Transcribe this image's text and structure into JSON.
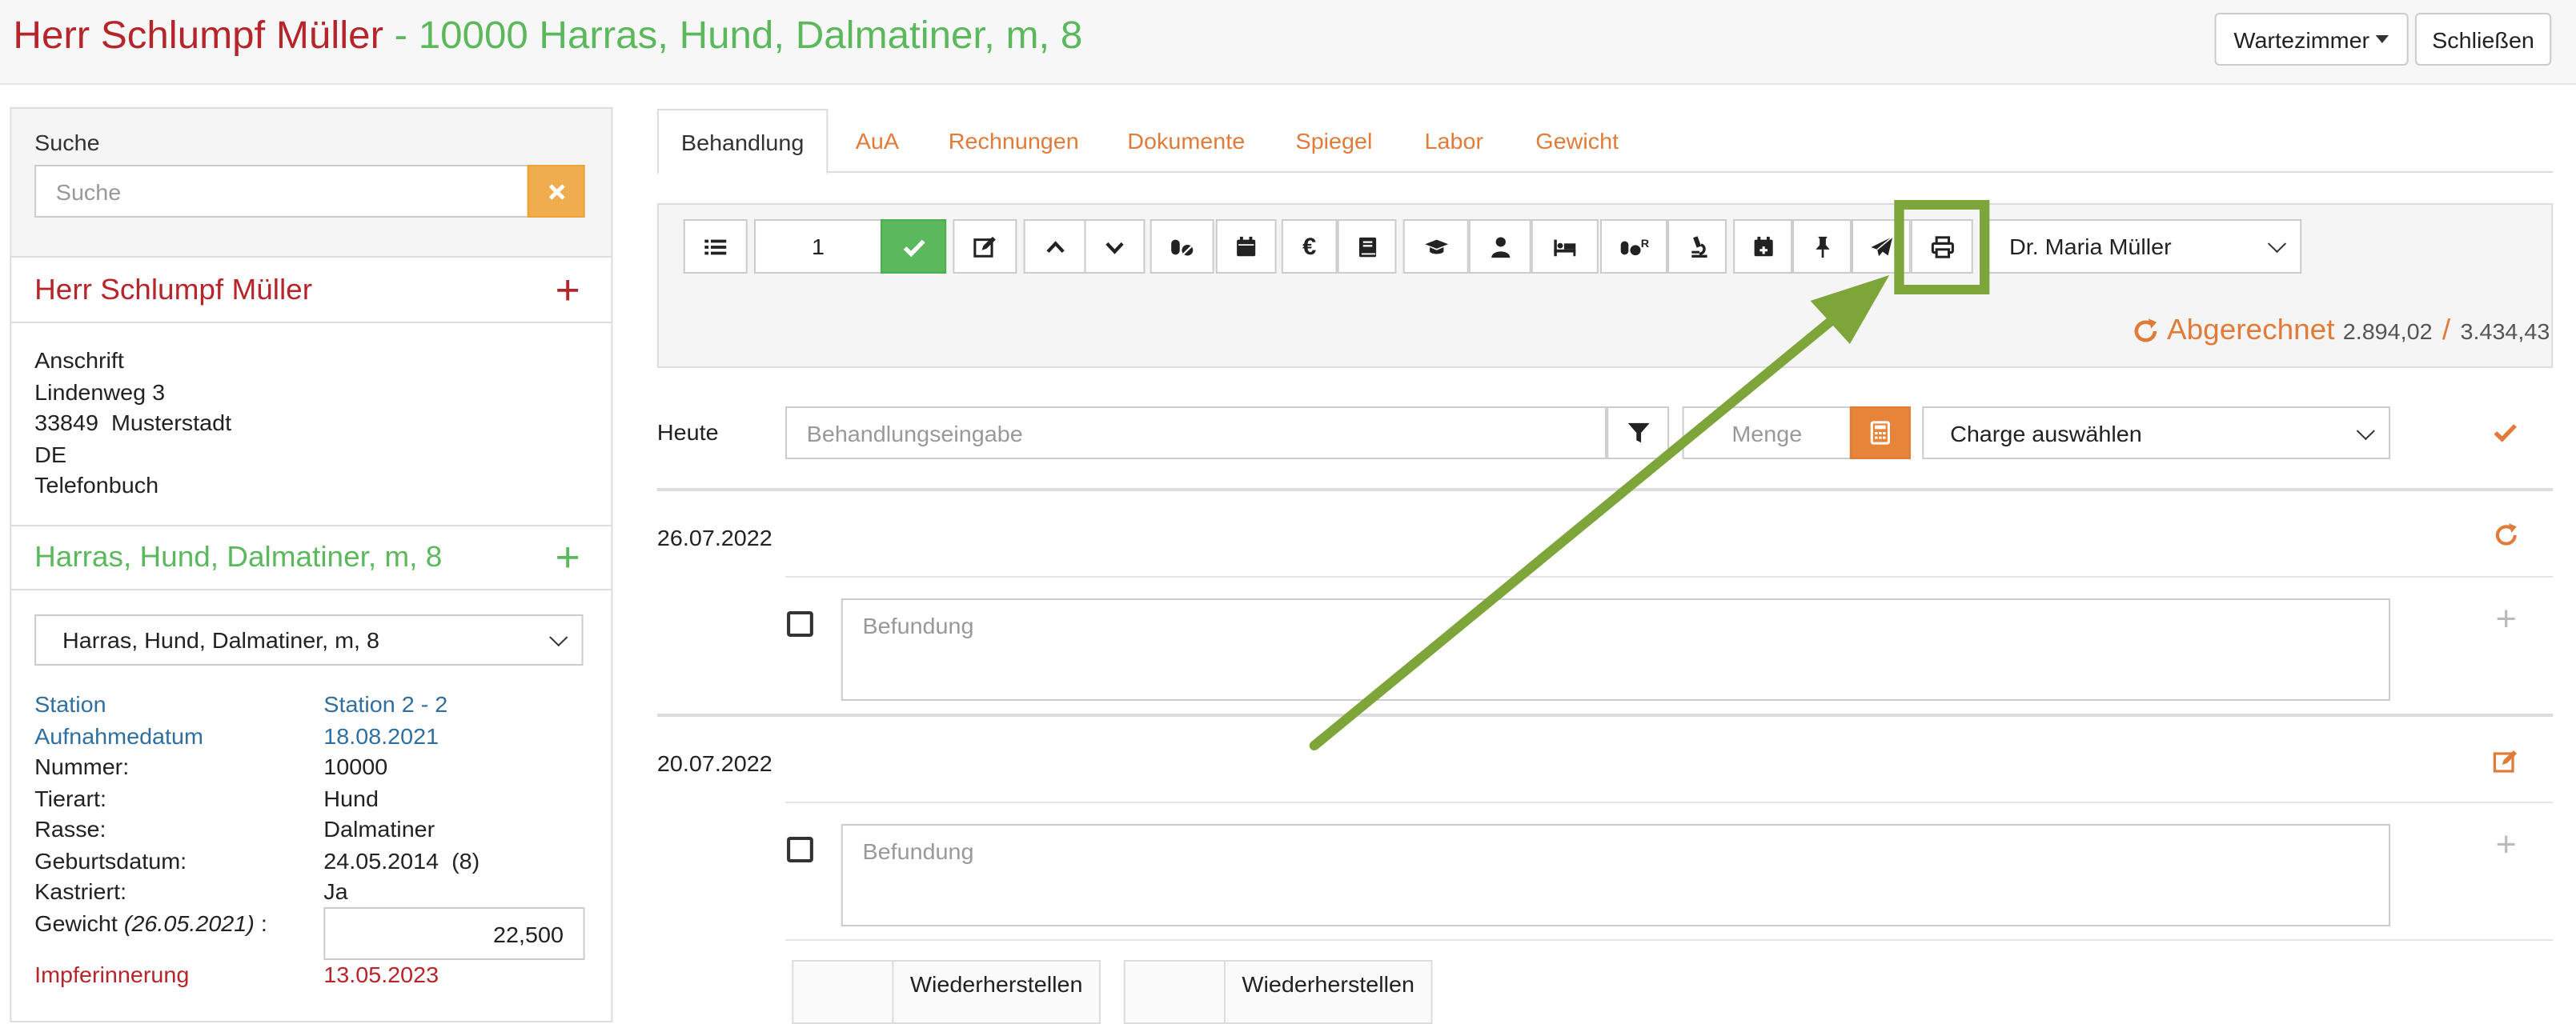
{
  "header": {
    "owner": "Herr Schlumpf Müller",
    "separator": " - ",
    "patient": "10000 Harras, Hund, Dalmatiner, m, 8",
    "waiting_room_label": "Wartezimmer",
    "close_label": "Schließen"
  },
  "sidebar": {
    "search_label": "Suche",
    "search_placeholder": "Suche",
    "owner_name": "Herr Schlumpf Müller",
    "address_lines": [
      "Anschrift",
      "Lindenweg 3",
      "33849  Musterstadt",
      "DE",
      "Telefonbuch"
    ],
    "patient_title": "Harras, Hund, Dalmatiner, m, 8",
    "patient_select": "Harras, Hund, Dalmatiner, m, 8",
    "details": [
      {
        "label": "Station",
        "value": "Station 2 - 2",
        "color": "blue"
      },
      {
        "label": "Aufnahmedatum",
        "value": "18.08.2021",
        "color": "blue"
      },
      {
        "label": "Nummer:",
        "value": "10000"
      },
      {
        "label": "Tierart:",
        "value": "Hund"
      },
      {
        "label": "Rasse:",
        "value": "Dalmatiner"
      },
      {
        "label": "Geburtsdatum:",
        "value": "24.05.2014  (8)"
      },
      {
        "label": "Kastriert:",
        "value": "Ja"
      }
    ],
    "weight_label": "Gewicht",
    "weight_date": "(26.05.2021)",
    "weight_suffix": " :",
    "weight_value": "22,500",
    "vaccine_label": "Impferinnerung",
    "vaccine_value": "13.05.2023"
  },
  "tabs": [
    "Behandlung",
    "AuA",
    "Rechnungen",
    "Dokumente",
    "Spiegel",
    "Labor",
    "Gewicht"
  ],
  "toolbar": {
    "quantity": "1",
    "doctor": "Dr. Maria Müller",
    "billed_label": "Abgerechnet",
    "billed_amount": "2.894,02",
    "slash": "/",
    "total_amount": "3.434,43",
    "icons": [
      "list-icon",
      "check-icon",
      "edit-icon",
      "chevron-up-icon",
      "chevron-down-icon",
      "pills-icon",
      "calendar-icon",
      "euro-icon",
      "book-icon",
      "graduation-cap-icon",
      "user-icon",
      "bed-icon",
      "pills-r-icon",
      "microscope-icon",
      "calendar-plus-icon",
      "thumbtack-icon",
      "paper-plane-icon",
      "print-icon"
    ]
  },
  "entry": {
    "today_label": "Heute",
    "treatment_placeholder": "Behandlungseingabe",
    "quantity_placeholder": "Menge",
    "batch_placeholder": "Charge auswählen"
  },
  "records": [
    {
      "date": "26.07.2022",
      "finding_placeholder": "Befundung"
    },
    {
      "date": "20.07.2022",
      "finding_placeholder": "Befundung"
    }
  ],
  "bottom_buttons": [
    "Wiederherstellen",
    "Wiederherstellen"
  ],
  "colors": {
    "owner": "#b5252a",
    "patient": "#5cb85c",
    "accent": "#e07b39",
    "annotation": "#7da53a"
  }
}
